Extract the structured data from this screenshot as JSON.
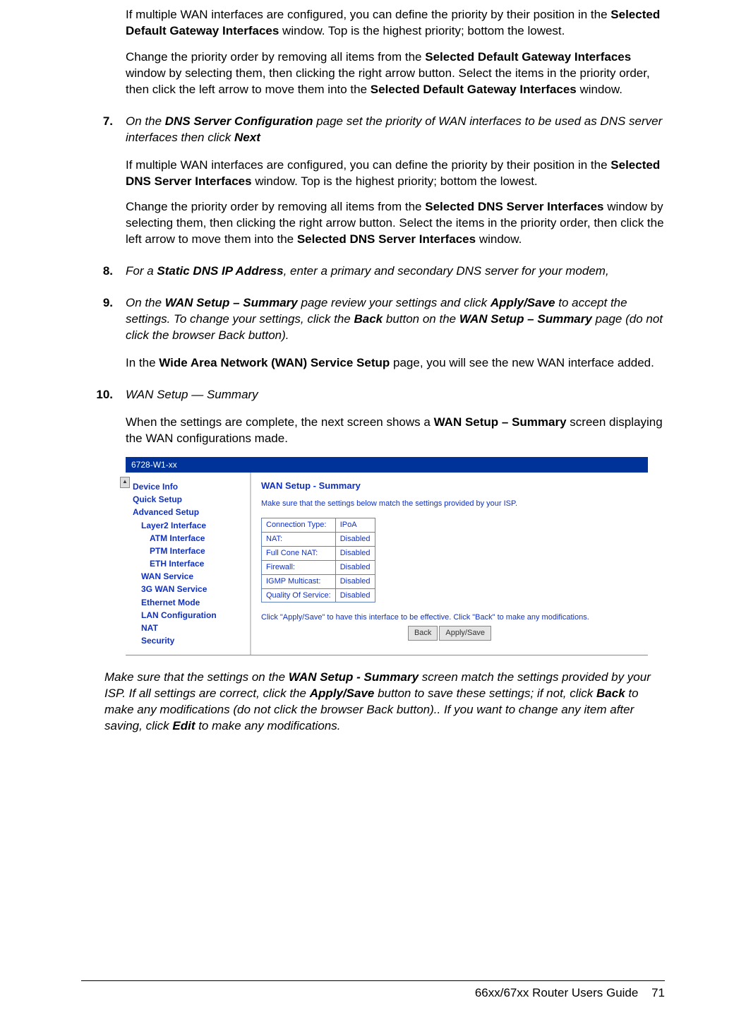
{
  "para1": {
    "t1": "If multiple WAN interfaces are configured, you can define the priority by their position in the ",
    "b1": "Selected Default Gateway Interfaces",
    "t2": " window. Top is the highest priority; bottom the lowest."
  },
  "para2": {
    "t1": "Change the priority order by removing all items from the ",
    "b1": "Selected Default Gateway Interfaces",
    "t2": " window by selecting them, then clicking the right arrow button. Select the items in the priority order, then click the left arrow to move them into the ",
    "b2": "Selected Default Gateway Interfaces",
    "t3": " window."
  },
  "step7": {
    "num": "7.",
    "t1": "On the ",
    "b1": "DNS Server Configuration",
    "t2": " page set the priority of WAN interfaces to be used as DNS server interfaces then click ",
    "b2": "Next",
    "p1": {
      "t1": "If multiple WAN interfaces are configured, you can define the priority by their position in the ",
      "b1": "Selected DNS Server Interfaces",
      "t2": " window. Top is the highest priority; bottom the lowest."
    },
    "p2": {
      "t1": "Change the priority order by removing all items from the ",
      "b1": "Selected DNS Server Interfaces",
      "t2": " window by selecting them, then clicking the right arrow button. Select the items in the priority order, then click the left arrow to move them into the ",
      "b2": "Selected DNS Server Interfaces",
      "t3": " window."
    }
  },
  "step8": {
    "num": "8.",
    "t1": "For a ",
    "b1": "Static DNS IP Address",
    "t2": ", enter a primary and secondary DNS server for your modem,"
  },
  "step9": {
    "num": "9.",
    "t1": "On the ",
    "b1": "WAN Setup – Summary",
    "t2": " page review your settings and click ",
    "b2": "Apply/Save",
    "t3": " to accept the settings. To change your settings, click the ",
    "b3": "Back",
    "t4": " button on the ",
    "b4": "WAN Setup – Summary",
    "t5": " page (do not click the browser Back button).",
    "p1": {
      "t1": "In the ",
      "b1": "Wide Area Network (WAN) Service Setup",
      "t2": " page, you will see the new WAN interface added."
    }
  },
  "step10": {
    "num": "10.",
    "t1": "WAN Setup — Summary",
    "p1": {
      "t1": "When the settings are complete, the next screen shows a ",
      "b1": "WAN Setup – Summary",
      "t2": " screen displaying the WAN configurations made."
    }
  },
  "shot": {
    "title": "6728-W1-xx",
    "nav": [
      {
        "label": "Device Info",
        "cls": ""
      },
      {
        "label": "Quick Setup",
        "cls": ""
      },
      {
        "label": "Advanced Setup",
        "cls": ""
      },
      {
        "label": "Layer2 Interface",
        "cls": "nav-sub1"
      },
      {
        "label": "ATM Interface",
        "cls": "nav-sub2"
      },
      {
        "label": "PTM Interface",
        "cls": "nav-sub2"
      },
      {
        "label": "ETH Interface",
        "cls": "nav-sub2"
      },
      {
        "label": "WAN Service",
        "cls": "nav-sub1"
      },
      {
        "label": "3G WAN Service",
        "cls": "nav-sub1"
      },
      {
        "label": "Ethernet Mode",
        "cls": "nav-sub1"
      },
      {
        "label": "LAN Configuration",
        "cls": "nav-sub1"
      },
      {
        "label": "NAT",
        "cls": "nav-sub1"
      },
      {
        "label": "Security",
        "cls": "nav-sub1"
      }
    ],
    "content_title": "WAN Setup - Summary",
    "content_sub": "Make sure that the settings below match the settings provided by your ISP.",
    "rows": [
      {
        "k": "Connection Type:",
        "v": "IPoA"
      },
      {
        "k": "NAT:",
        "v": "Disabled"
      },
      {
        "k": "Full Cone NAT:",
        "v": "Disabled"
      },
      {
        "k": "Firewall:",
        "v": "Disabled"
      },
      {
        "k": "IGMP Multicast:",
        "v": "Disabled"
      },
      {
        "k": "Quality Of Service:",
        "v": "Disabled"
      }
    ],
    "hint": "Click \"Apply/Save\" to have this interface to be effective. Click \"Back\" to make any modifications.",
    "btn_back": "Back",
    "btn_apply": "Apply/Save"
  },
  "after": {
    "t1": "Make sure that the settings on the ",
    "b1": "WAN Setup - Summary",
    "t2": " screen match the settings provided by your ISP. If all settings are correct, click the ",
    "b2": "Apply/Save",
    "t3": " button to save these settings; if not, click ",
    "b3": "Back",
    "t4": " to make any modifications (do not click the browser Back button).. If you want to change any item after saving, click ",
    "b4": "Edit",
    "t5": " to make any modifications."
  },
  "footer": {
    "title": "66xx/67xx Router Users Guide",
    "page": "71"
  }
}
